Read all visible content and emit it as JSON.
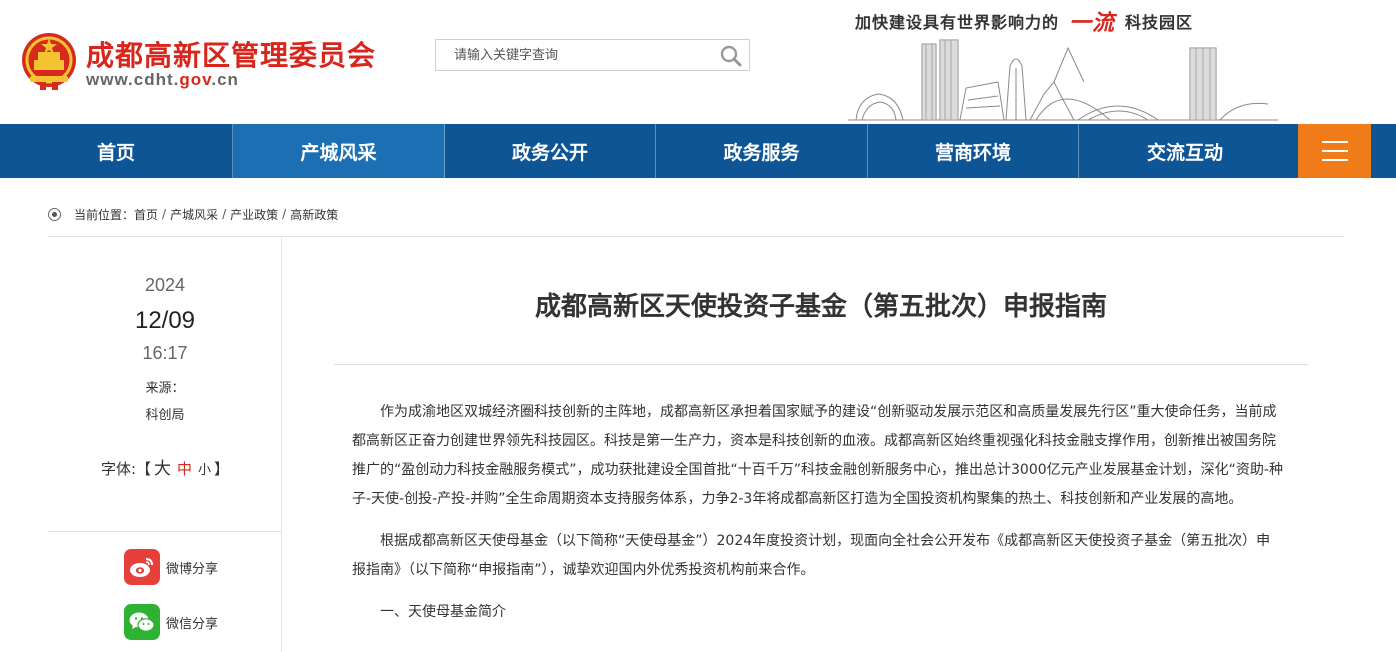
{
  "header": {
    "site_title": "成都高新区管理委员会",
    "domain_prefix": "www.cdht.",
    "domain_hl": "gov",
    "domain_suffix": ".cn",
    "slogan_before": "加快建设具有世界影响力的",
    "slogan_highlight": "一流",
    "slogan_after": "科技园区"
  },
  "search": {
    "placeholder": "请输入关键字查询"
  },
  "nav": {
    "items": [
      {
        "label": "首页"
      },
      {
        "label": "产城风采"
      },
      {
        "label": "政务公开"
      },
      {
        "label": "政务服务"
      },
      {
        "label": "营商环境"
      },
      {
        "label": "交流互动"
      }
    ]
  },
  "breadcrumb": {
    "label": "当前位置：",
    "items": [
      "首页",
      "产城风采",
      "产业政策",
      "高新政策"
    ],
    "separator": "/"
  },
  "meta": {
    "year": "2024",
    "date": "12/09",
    "time": "16:17",
    "source_label": "来源：",
    "source": "科创局",
    "font_label": "字体:",
    "font_open": "【",
    "font_big": "大",
    "font_mid": "中",
    "font_small": "小",
    "font_close": "】"
  },
  "share": {
    "weibo": "微博分享",
    "wechat": "微信分享"
  },
  "article": {
    "title": "成都高新区天使投资子基金（第五批次）申报指南",
    "paragraphs": [
      "作为成渝地区双城经济圈科技创新的主阵地，成都高新区承担着国家赋予的建设“创新驱动发展示范区和高质量发展先行区”重大使命任务，当前成都高新区正奋力创建世界领先科技园区。科技是第一生产力，资本是科技创新的血液。成都高新区始终重视强化科技金融支撑作用，创新推出被国务院推广的“盈创动力科技金融服务模式”，成功获批建设全国首批“十百千万”科技金融创新服务中心，推出总计3000亿元产业发展基金计划，深化“资助-种子-天使-创投-产投-并购”全生命周期资本支持服务体系，力争2-3年将成都高新区打造为全国投资机构聚集的热土、科技创新和产业发展的高地。",
      "根据成都高新区天使母基金（以下简称“天使母基金”）2024年度投资计划，现面向全社会公开发布《成都高新区天使投资子基金（第五批次）申报指南》（以下简称“申报指南”），诚挚欢迎国内外优秀投资机构前来合作。"
    ],
    "section1": "一、天使母基金简介"
  },
  "colors": {
    "brand_red": "#d9261c",
    "nav_blue": "#0d5595",
    "nav_active": "#1d6fb3",
    "menu_orange": "#ef7b19",
    "weibo_red": "#e6403a",
    "wechat_green": "#2db233"
  },
  "icons": [
    "national-emblem-icon",
    "search-icon",
    "skyline-illustration",
    "menu-icon",
    "location-dot-icon",
    "weibo-icon",
    "wechat-icon"
  ]
}
